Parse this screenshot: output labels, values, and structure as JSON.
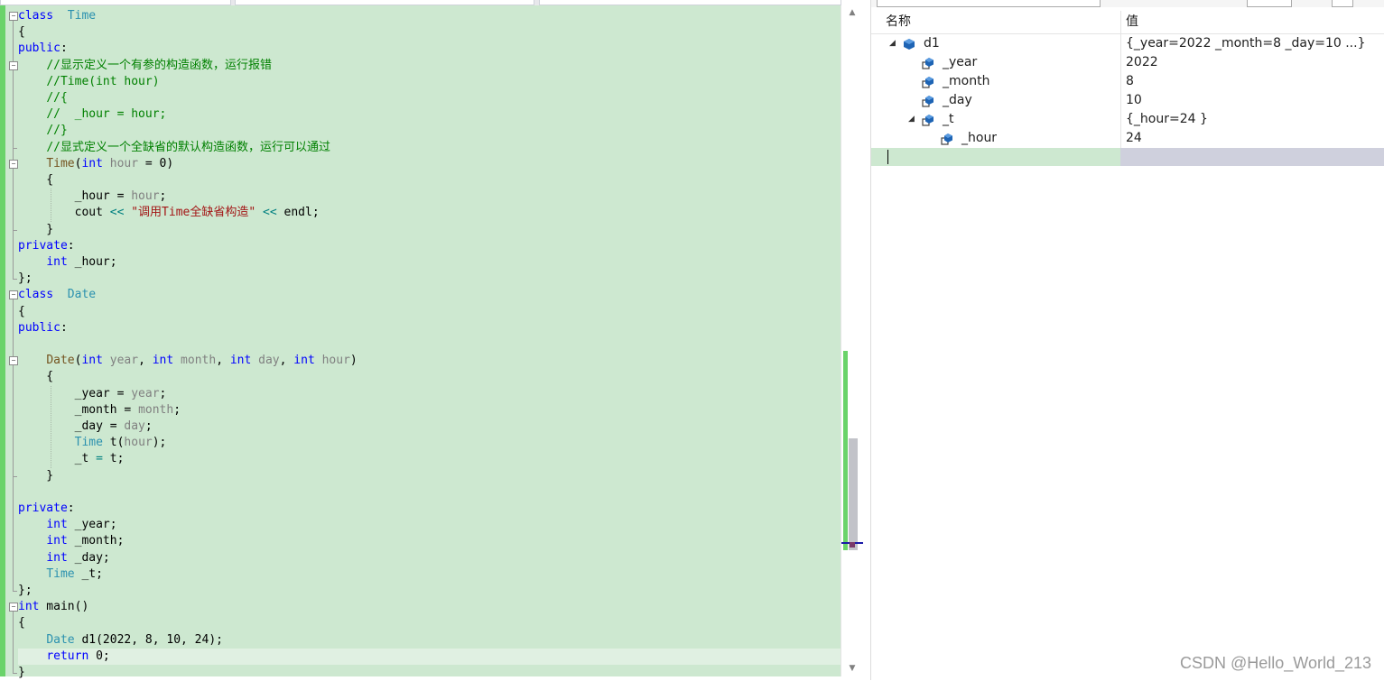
{
  "editor": {
    "lines": [
      [
        [
          "kw",
          "class"
        ],
        [
          "",
          "  "
        ],
        [
          "ty",
          "Time"
        ]
      ],
      [
        [
          "",
          "{"
        ]
      ],
      [
        [
          "kw",
          "public"
        ],
        [
          "",
          ":"
        ]
      ],
      [
        [
          "",
          "    "
        ],
        [
          "cm",
          "//显示定义一个有参的构造函数，运行报错"
        ]
      ],
      [
        [
          "",
          "    "
        ],
        [
          "cm",
          "//Time(int hour)"
        ]
      ],
      [
        [
          "",
          "    "
        ],
        [
          "cm",
          "//{"
        ]
      ],
      [
        [
          "",
          "    "
        ],
        [
          "cm",
          "//  _hour = hour;"
        ]
      ],
      [
        [
          "",
          "    "
        ],
        [
          "cm",
          "//}"
        ]
      ],
      [
        [
          "",
          "    "
        ],
        [
          "cm",
          "//显式定义一个全缺省的默认构造函数，运行可以通过"
        ]
      ],
      [
        [
          "",
          "    "
        ],
        [
          "fn",
          "Time"
        ],
        [
          "",
          "("
        ],
        [
          "kw",
          "int"
        ],
        [
          "",
          ""
        ],
        [
          "pm",
          " hour"
        ],
        [
          "",
          " = 0)"
        ]
      ],
      [
        [
          "",
          "    {"
        ]
      ],
      [
        [
          "",
          "        _hour = "
        ],
        [
          "pm",
          "hour"
        ],
        [
          "",
          ";"
        ]
      ],
      [
        [
          "",
          "        cout "
        ],
        [
          "op",
          "<<"
        ],
        [
          "",
          " "
        ],
        [
          "st",
          "\"调用Time全缺省构造\""
        ],
        [
          "",
          " "
        ],
        [
          "op",
          "<<"
        ],
        [
          "",
          " endl;"
        ]
      ],
      [
        [
          "",
          "    }"
        ]
      ],
      [
        [
          "kw",
          "private"
        ],
        [
          "",
          ":"
        ]
      ],
      [
        [
          "",
          "    "
        ],
        [
          "kw",
          "int"
        ],
        [
          "",
          " _hour;"
        ]
      ],
      [
        [
          "",
          "};"
        ]
      ],
      [
        [
          "kw",
          "class"
        ],
        [
          "",
          "  "
        ],
        [
          "ty",
          "Date"
        ]
      ],
      [
        [
          "",
          "{"
        ]
      ],
      [
        [
          "kw",
          "public"
        ],
        [
          "",
          ":"
        ]
      ],
      [
        [
          "",
          ""
        ]
      ],
      [
        [
          "",
          "    "
        ],
        [
          "fn",
          "Date"
        ],
        [
          "",
          "("
        ],
        [
          "kw",
          "int"
        ],
        [
          "pm",
          " year"
        ],
        [
          "",
          ", "
        ],
        [
          "kw",
          "int"
        ],
        [
          "pm",
          " month"
        ],
        [
          "",
          ", "
        ],
        [
          "kw",
          "int"
        ],
        [
          "pm",
          " day"
        ],
        [
          "",
          ", "
        ],
        [
          "kw",
          "int"
        ],
        [
          "pm",
          " hour"
        ],
        [
          "",
          ")"
        ]
      ],
      [
        [
          "",
          "    {"
        ]
      ],
      [
        [
          "",
          "        _year = "
        ],
        [
          "pm",
          "year"
        ],
        [
          "",
          ";"
        ]
      ],
      [
        [
          "",
          "        _month = "
        ],
        [
          "pm",
          "month"
        ],
        [
          "",
          ";"
        ]
      ],
      [
        [
          "",
          "        _day = "
        ],
        [
          "pm",
          "day"
        ],
        [
          "",
          ";"
        ]
      ],
      [
        [
          "",
          "        "
        ],
        [
          "ty",
          "Time"
        ],
        [
          "",
          " t("
        ],
        [
          "pm",
          "hour"
        ],
        [
          "",
          "); "
        ]
      ],
      [
        [
          "",
          "        _t "
        ],
        [
          "op",
          "="
        ],
        [
          "",
          " t;"
        ]
      ],
      [
        [
          "",
          "    }"
        ]
      ],
      [
        [
          "",
          ""
        ]
      ],
      [
        [
          "kw",
          "private"
        ],
        [
          "",
          ":"
        ]
      ],
      [
        [
          "",
          "    "
        ],
        [
          "kw",
          "int"
        ],
        [
          "",
          " _year;"
        ]
      ],
      [
        [
          "",
          "    "
        ],
        [
          "kw",
          "int"
        ],
        [
          "",
          " _month;"
        ]
      ],
      [
        [
          "",
          "    "
        ],
        [
          "kw",
          "int"
        ],
        [
          "",
          " _day;"
        ]
      ],
      [
        [
          "",
          "    "
        ],
        [
          "ty",
          "Time"
        ],
        [
          "",
          " _t;"
        ]
      ],
      [
        [
          "",
          "};"
        ]
      ],
      [
        [
          "kw",
          "int"
        ],
        [
          "",
          " main()"
        ]
      ],
      [
        [
          "",
          "{"
        ]
      ],
      [
        [
          "",
          "    "
        ],
        [
          "ty",
          "Date"
        ],
        [
          "",
          " d1(2022, 8, 10, 24);"
        ]
      ],
      [
        [
          "",
          "    "
        ],
        [
          "kw",
          "return"
        ],
        [
          "",
          " 0;"
        ]
      ],
      [
        [
          "",
          "}"
        ]
      ]
    ],
    "current_line": 39
  },
  "watch": {
    "header_name": "名称",
    "header_value": "值",
    "rows": [
      {
        "name": "d1",
        "value": "{_year=2022 _month=8 _day=10 ...}",
        "level": 0,
        "expanded": true,
        "icon": "object-icon"
      },
      {
        "name": "_year",
        "value": "2022",
        "level": 1,
        "expanded": null,
        "icon": "field-icon"
      },
      {
        "name": "_month",
        "value": "8",
        "level": 1,
        "expanded": null,
        "icon": "field-icon"
      },
      {
        "name": "_day",
        "value": "10",
        "level": 1,
        "expanded": null,
        "icon": "field-icon"
      },
      {
        "name": "_t",
        "value": "{_hour=24 }",
        "level": 1,
        "expanded": true,
        "icon": "field-icon"
      },
      {
        "name": "_hour",
        "value": "24",
        "level": 2,
        "expanded": null,
        "icon": "field-icon"
      }
    ]
  },
  "colors": {
    "editor_bg": "#cde8d0",
    "keyword": "#0000ff",
    "type": "#2b91af",
    "comment": "#008000",
    "string": "#a31515",
    "change_bar": "#6ad36a"
  },
  "watermark": "CSDN @Hello_World_213"
}
